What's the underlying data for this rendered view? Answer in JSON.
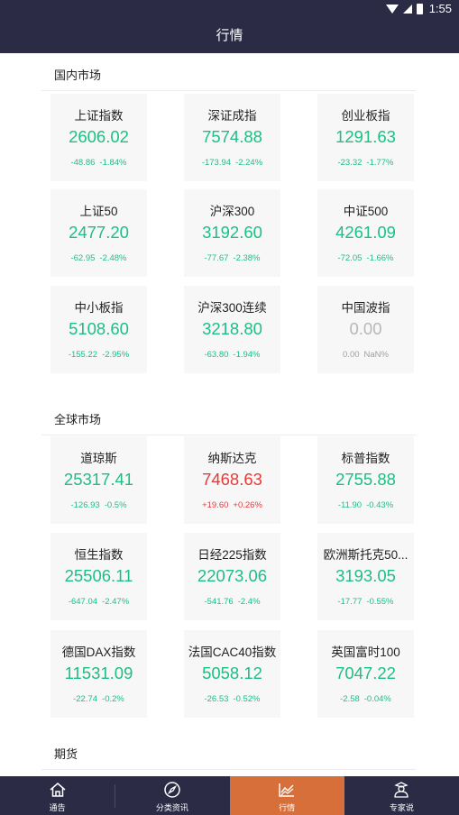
{
  "status_bar": {
    "time": "1:55"
  },
  "header": {
    "title": "行情"
  },
  "sections": {
    "domestic": {
      "title": "国内市场",
      "cards": [
        {
          "name": "上证指数",
          "price": "2606.02",
          "change": "-48.86",
          "pct": "-1.84%",
          "color": "green"
        },
        {
          "name": "深证成指",
          "price": "7574.88",
          "change": "-173.94",
          "pct": "-2.24%",
          "color": "green"
        },
        {
          "name": "创业板指",
          "price": "1291.63",
          "change": "-23.32",
          "pct": "-1.77%",
          "color": "green"
        },
        {
          "name": "上证50",
          "price": "2477.20",
          "change": "-62.95",
          "pct": "-2.48%",
          "color": "green"
        },
        {
          "name": "沪深300",
          "price": "3192.60",
          "change": "-77.67",
          "pct": "-2.38%",
          "color": "green"
        },
        {
          "name": "中证500",
          "price": "4261.09",
          "change": "-72.05",
          "pct": "-1.66%",
          "color": "green"
        },
        {
          "name": "中小板指",
          "price": "5108.60",
          "change": "-155.22",
          "pct": "-2.95%",
          "color": "green"
        },
        {
          "name": "沪深300连续",
          "price": "3218.80",
          "change": "-63.80",
          "pct": "-1.94%",
          "color": "green"
        },
        {
          "name": "中国波指",
          "price": "0.00",
          "change": "0.00",
          "pct": "NaN%",
          "color": "grey"
        }
      ]
    },
    "global": {
      "title": "全球市场",
      "cards": [
        {
          "name": "道琼斯",
          "price": "25317.41",
          "change": "-126.93",
          "pct": "-0.5%",
          "color": "green"
        },
        {
          "name": "纳斯达克",
          "price": "7468.63",
          "change": "+19.60",
          "pct": "+0.26%",
          "color": "red"
        },
        {
          "name": "标普指数",
          "price": "2755.88",
          "change": "-11.90",
          "pct": "-0.43%",
          "color": "green"
        },
        {
          "name": "恒生指数",
          "price": "25506.11",
          "change": "-647.04",
          "pct": "-2.47%",
          "color": "green"
        },
        {
          "name": "日经225指数",
          "price": "22073.06",
          "change": "-541.76",
          "pct": "-2.4%",
          "color": "green"
        },
        {
          "name": "欧洲斯托克50...",
          "price": "3193.05",
          "change": "-17.77",
          "pct": "-0.55%",
          "color": "green"
        },
        {
          "name": "德国DAX指数",
          "price": "11531.09",
          "change": "-22.74",
          "pct": "-0.2%",
          "color": "green"
        },
        {
          "name": "法国CAC40指数",
          "price": "5058.12",
          "change": "-26.53",
          "pct": "-0.52%",
          "color": "green"
        },
        {
          "name": "英国富时100",
          "price": "7047.22",
          "change": "-2.58",
          "pct": "-0.04%",
          "color": "green"
        }
      ]
    },
    "futures": {
      "title": "期货"
    }
  },
  "nav": {
    "tabs": [
      {
        "label": "通告",
        "icon": "home-icon"
      },
      {
        "label": "分类资讯",
        "icon": "compass-icon"
      },
      {
        "label": "行情",
        "icon": "trend-chart-icon",
        "active": true
      },
      {
        "label": "专家说",
        "icon": "expert-icon"
      }
    ]
  },
  "colors": {
    "dark": "#2b2b46",
    "accent": "#d66f3a",
    "up": "#e53b3b",
    "down": "#1fbe84",
    "flat": "#b7b7b7"
  }
}
